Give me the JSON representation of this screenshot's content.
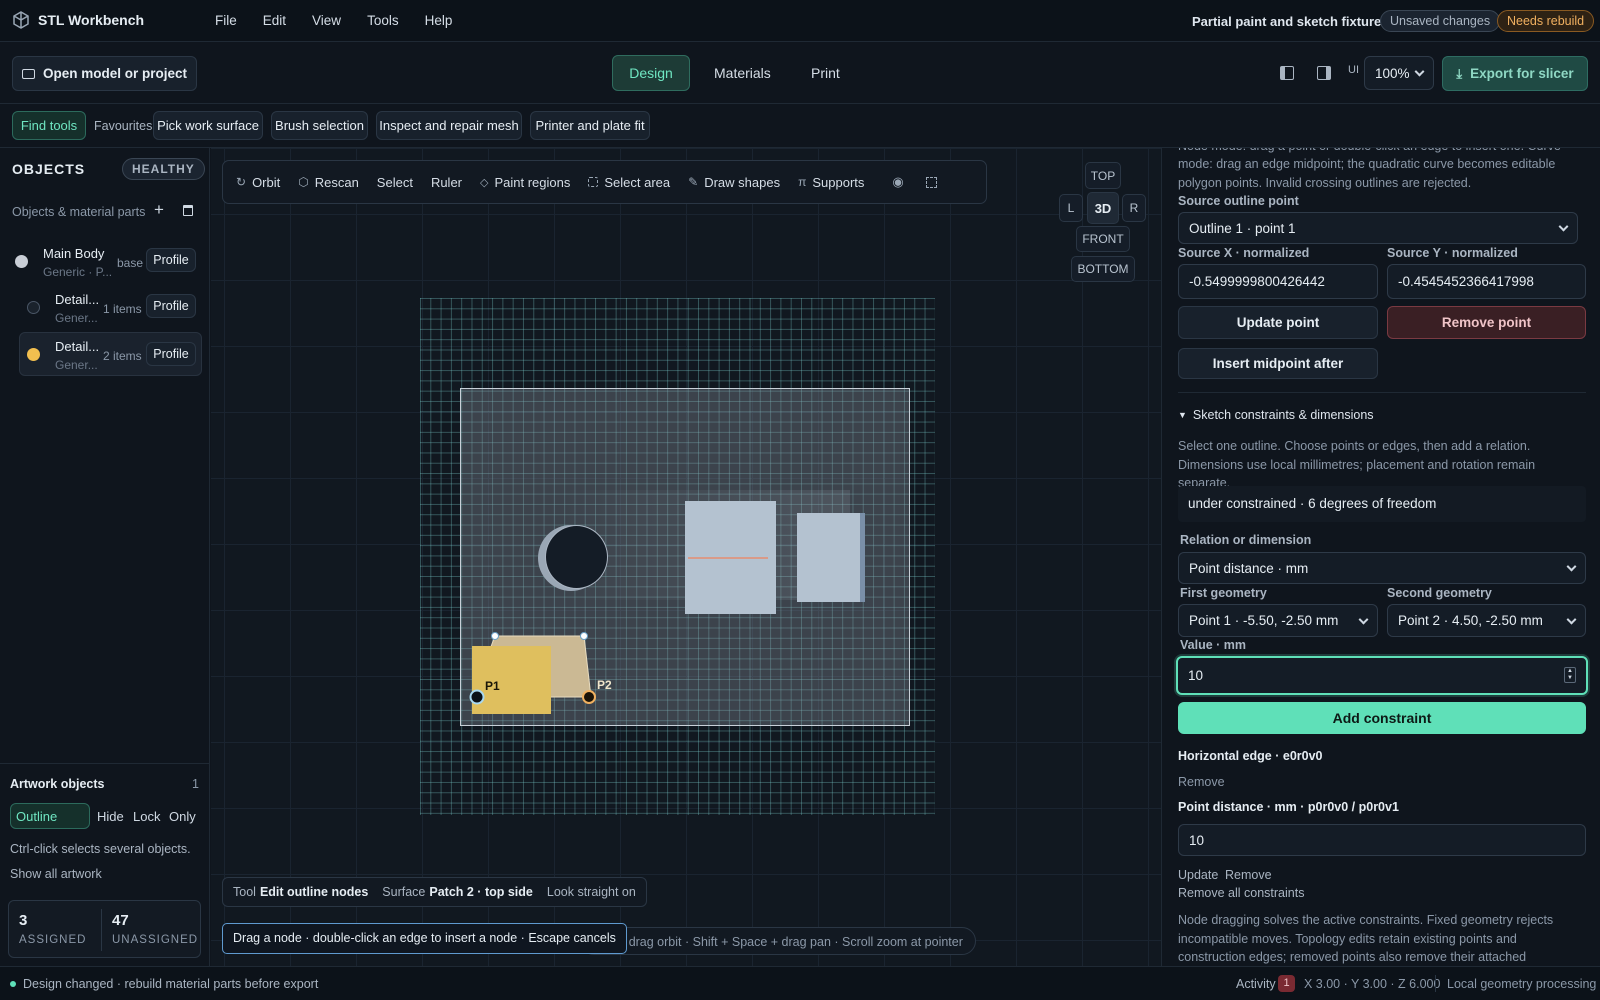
{
  "app": {
    "title": "STL Workbench"
  },
  "menu": [
    "File",
    "Edit",
    "View",
    "Tools",
    "Help"
  ],
  "file": {
    "name": "Partial paint and sketch fixture.stl",
    "unsaved": "Unsaved changes",
    "rebuild": "Needs rebuild"
  },
  "toolbar": {
    "open": "Open model or project",
    "tabs": [
      "Design",
      "Materials",
      "Print"
    ],
    "ui_label": "UI",
    "zoom": "100%",
    "export": "Export for slicer"
  },
  "quickbar": {
    "find": "Find tools",
    "fav": "Favourites",
    "items": [
      "Pick work surface",
      "Brush selection",
      "Inspect and repair mesh",
      "Printer and plate fit"
    ]
  },
  "objects": {
    "title": "OBJECTS",
    "health": "HEALTHY",
    "subtitle": "Objects & material parts",
    "items": [
      {
        "name": "Main Body",
        "sub": "Generic · P...",
        "meta": "base",
        "profile": "Profile",
        "color": "#c9ced6"
      },
      {
        "name": "Detail...",
        "sub": "Gener...",
        "meta": "1 items",
        "profile": "Profile",
        "color": "#1a222c"
      },
      {
        "name": "Detail...",
        "sub": "Gener...",
        "meta": "2 items",
        "profile": "Profile",
        "color": "#f2bf4f"
      }
    ]
  },
  "artwork": {
    "title": "Artwork objects",
    "count": "1",
    "mode": "Outline",
    "hide": "Hide",
    "lock": "Lock",
    "only": "Only",
    "hint": "Ctrl-click selects several objects.",
    "show_all": "Show all artwork"
  },
  "stats": {
    "assigned": "3",
    "assigned_label": "ASSIGNED",
    "unassigned": "47",
    "unassigned_label": "UNASSIGNED"
  },
  "viewport_tools": [
    "Orbit",
    "Rescan",
    "Select",
    "Ruler",
    "Paint regions",
    "Select area",
    "Draw shapes",
    "Supports"
  ],
  "views": {
    "top": "TOP",
    "l": "L",
    "three_d": "3D",
    "r": "R",
    "front": "FRONT",
    "bottom": "BOTTOM"
  },
  "scene": {
    "p1": "P1",
    "p2": "P2"
  },
  "status_chip": {
    "tool_label": "Tool",
    "tool": "Edit outline nodes",
    "surface_label": "Surface",
    "surface": "Patch 2 · top side",
    "look": "Look straight on"
  },
  "tip": "Drag a node · double-click an edge to insert a node · Escape cancels",
  "nav_hint": "Space + drag orbit · Shift + Space + drag pan · Scroll zoom at pointer",
  "panel": {
    "intro": "Node mode: drag a point or double-click an edge to insert one. Curve mode: drag an edge midpoint; the quadratic curve becomes editable polygon points. Invalid crossing outlines are rejected.",
    "src_label": "Source outline point",
    "src_value": "Outline 1 · point 1",
    "sx_label": "Source X · normalized",
    "sx": "-0.5499999800426442",
    "sy_label": "Source Y · normalized",
    "sy": "-0.4545452366417998",
    "update": "Update point",
    "remove": "Remove point",
    "insert": "Insert midpoint after",
    "section": "Sketch constraints & dimensions",
    "section_help": "Select one outline. Choose points or edges, then add a relation. Dimensions use local millimetres; placement and rotation remain separate.",
    "dof": "under constrained · 6 degrees of freedom",
    "rel_label": "Relation or dimension",
    "rel": "Point distance · mm",
    "g1_label": "First geometry",
    "g1": "Point 1 · -5.50, -2.50 mm",
    "g2_label": "Second geometry",
    "g2": "Point 2 · 4.50, -2.50 mm",
    "val_label": "Value · mm",
    "val": "10",
    "add": "Add constraint",
    "c1": "Horizontal edge · e0r0v0",
    "c1_remove": "Remove",
    "c2": "Point distance · mm · p0r0v0 / p0r0v1",
    "c2_val": "10",
    "c2_update": "Update",
    "c2_remove": "Remove",
    "remove_all": "Remove all constraints",
    "footer": "Node dragging solves the active constraints. Fixed geometry rejects incompatible moves. Topology edits retain existing points and construction edges; removed points also remove their attached constraints."
  },
  "statusbar": {
    "msg": "Design changed · rebuild material parts before export",
    "activity": "Activity",
    "activity_count": "1",
    "coords": "X 3.00 · Y 3.00 · Z 6.000",
    "processing": "Local geometry processing"
  },
  "colors": {
    "accent": "#5fe0b8",
    "warning": "#f0a64a",
    "paint": "#dfbf5e"
  }
}
